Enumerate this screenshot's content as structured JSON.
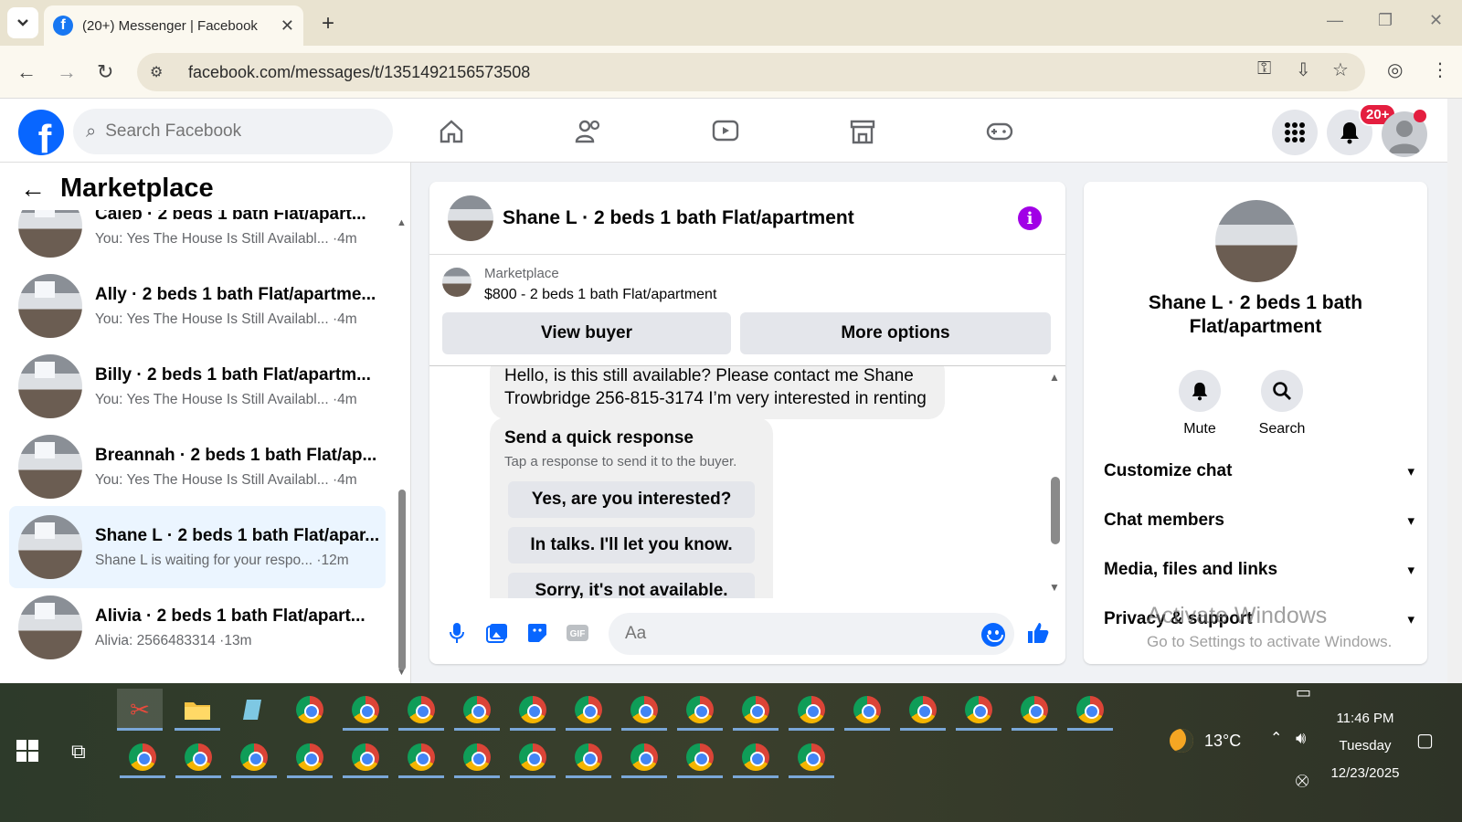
{
  "browser": {
    "tab_title": "(20+) Messenger | Facebook",
    "url": "facebook.com/messages/t/1351492156573508"
  },
  "fb_header": {
    "search_placeholder": "Search Facebook",
    "notification_badge": "20+"
  },
  "sidebar": {
    "title": "Marketplace",
    "conversations": [
      {
        "name": "Caleb · 2 beds 1 bath Flat/apart...",
        "preview": "You: Yes The House Is Still Availabl... ·4m"
      },
      {
        "name": "Ally · 2 beds 1 bath Flat/apartme...",
        "preview": "You: Yes The House Is Still Availabl... ·4m"
      },
      {
        "name": "Billy · 2 beds 1 bath Flat/apartm...",
        "preview": "You: Yes The House Is Still Availabl... ·4m"
      },
      {
        "name": "Breannah · 2 beds 1 bath Flat/ap...",
        "preview": "You: Yes The House Is Still Availabl... ·4m"
      },
      {
        "name": "Shane L · 2 beds 1 bath Flat/apar...",
        "preview": "Shane L is waiting for your respo... ·12m"
      },
      {
        "name": "Alivia · 2 beds 1 bath Flat/apart...",
        "preview": "Alivia: 2566483314 ·13m"
      }
    ]
  },
  "chat": {
    "title": "Shane L · 2 beds 1 bath Flat/apartment",
    "listing_label": "Marketplace",
    "listing_price": "$800 - 2 beds 1 bath Flat/apartment",
    "view_buyer": "View buyer",
    "more_options": "More options",
    "message": "Hello, is this still available? Please contact me Shane Trowbridge 256-815-3174 I’m very interested in renting",
    "quick_title": "Send a quick response",
    "quick_sub": "Tap a response to send it to the buyer.",
    "quick_replies": [
      "Yes, are you interested?",
      "In talks. I'll let you know.",
      "Sorry, it's not available."
    ],
    "composer_placeholder": "Aa"
  },
  "info_panel": {
    "name": "Shane L · 2 beds 1 bath Flat/apartment",
    "mute": "Mute",
    "search": "Search",
    "rows": [
      "Customize chat",
      "Chat members",
      "Media, files and links",
      "Privacy & support"
    ]
  },
  "watermark": {
    "line1": "Activate Windows",
    "line2": "Go to Settings to activate Windows."
  },
  "taskbar": {
    "temperature": "13°C",
    "time": "11:46 PM",
    "day": "Tuesday",
    "date": "12/23/2025"
  }
}
